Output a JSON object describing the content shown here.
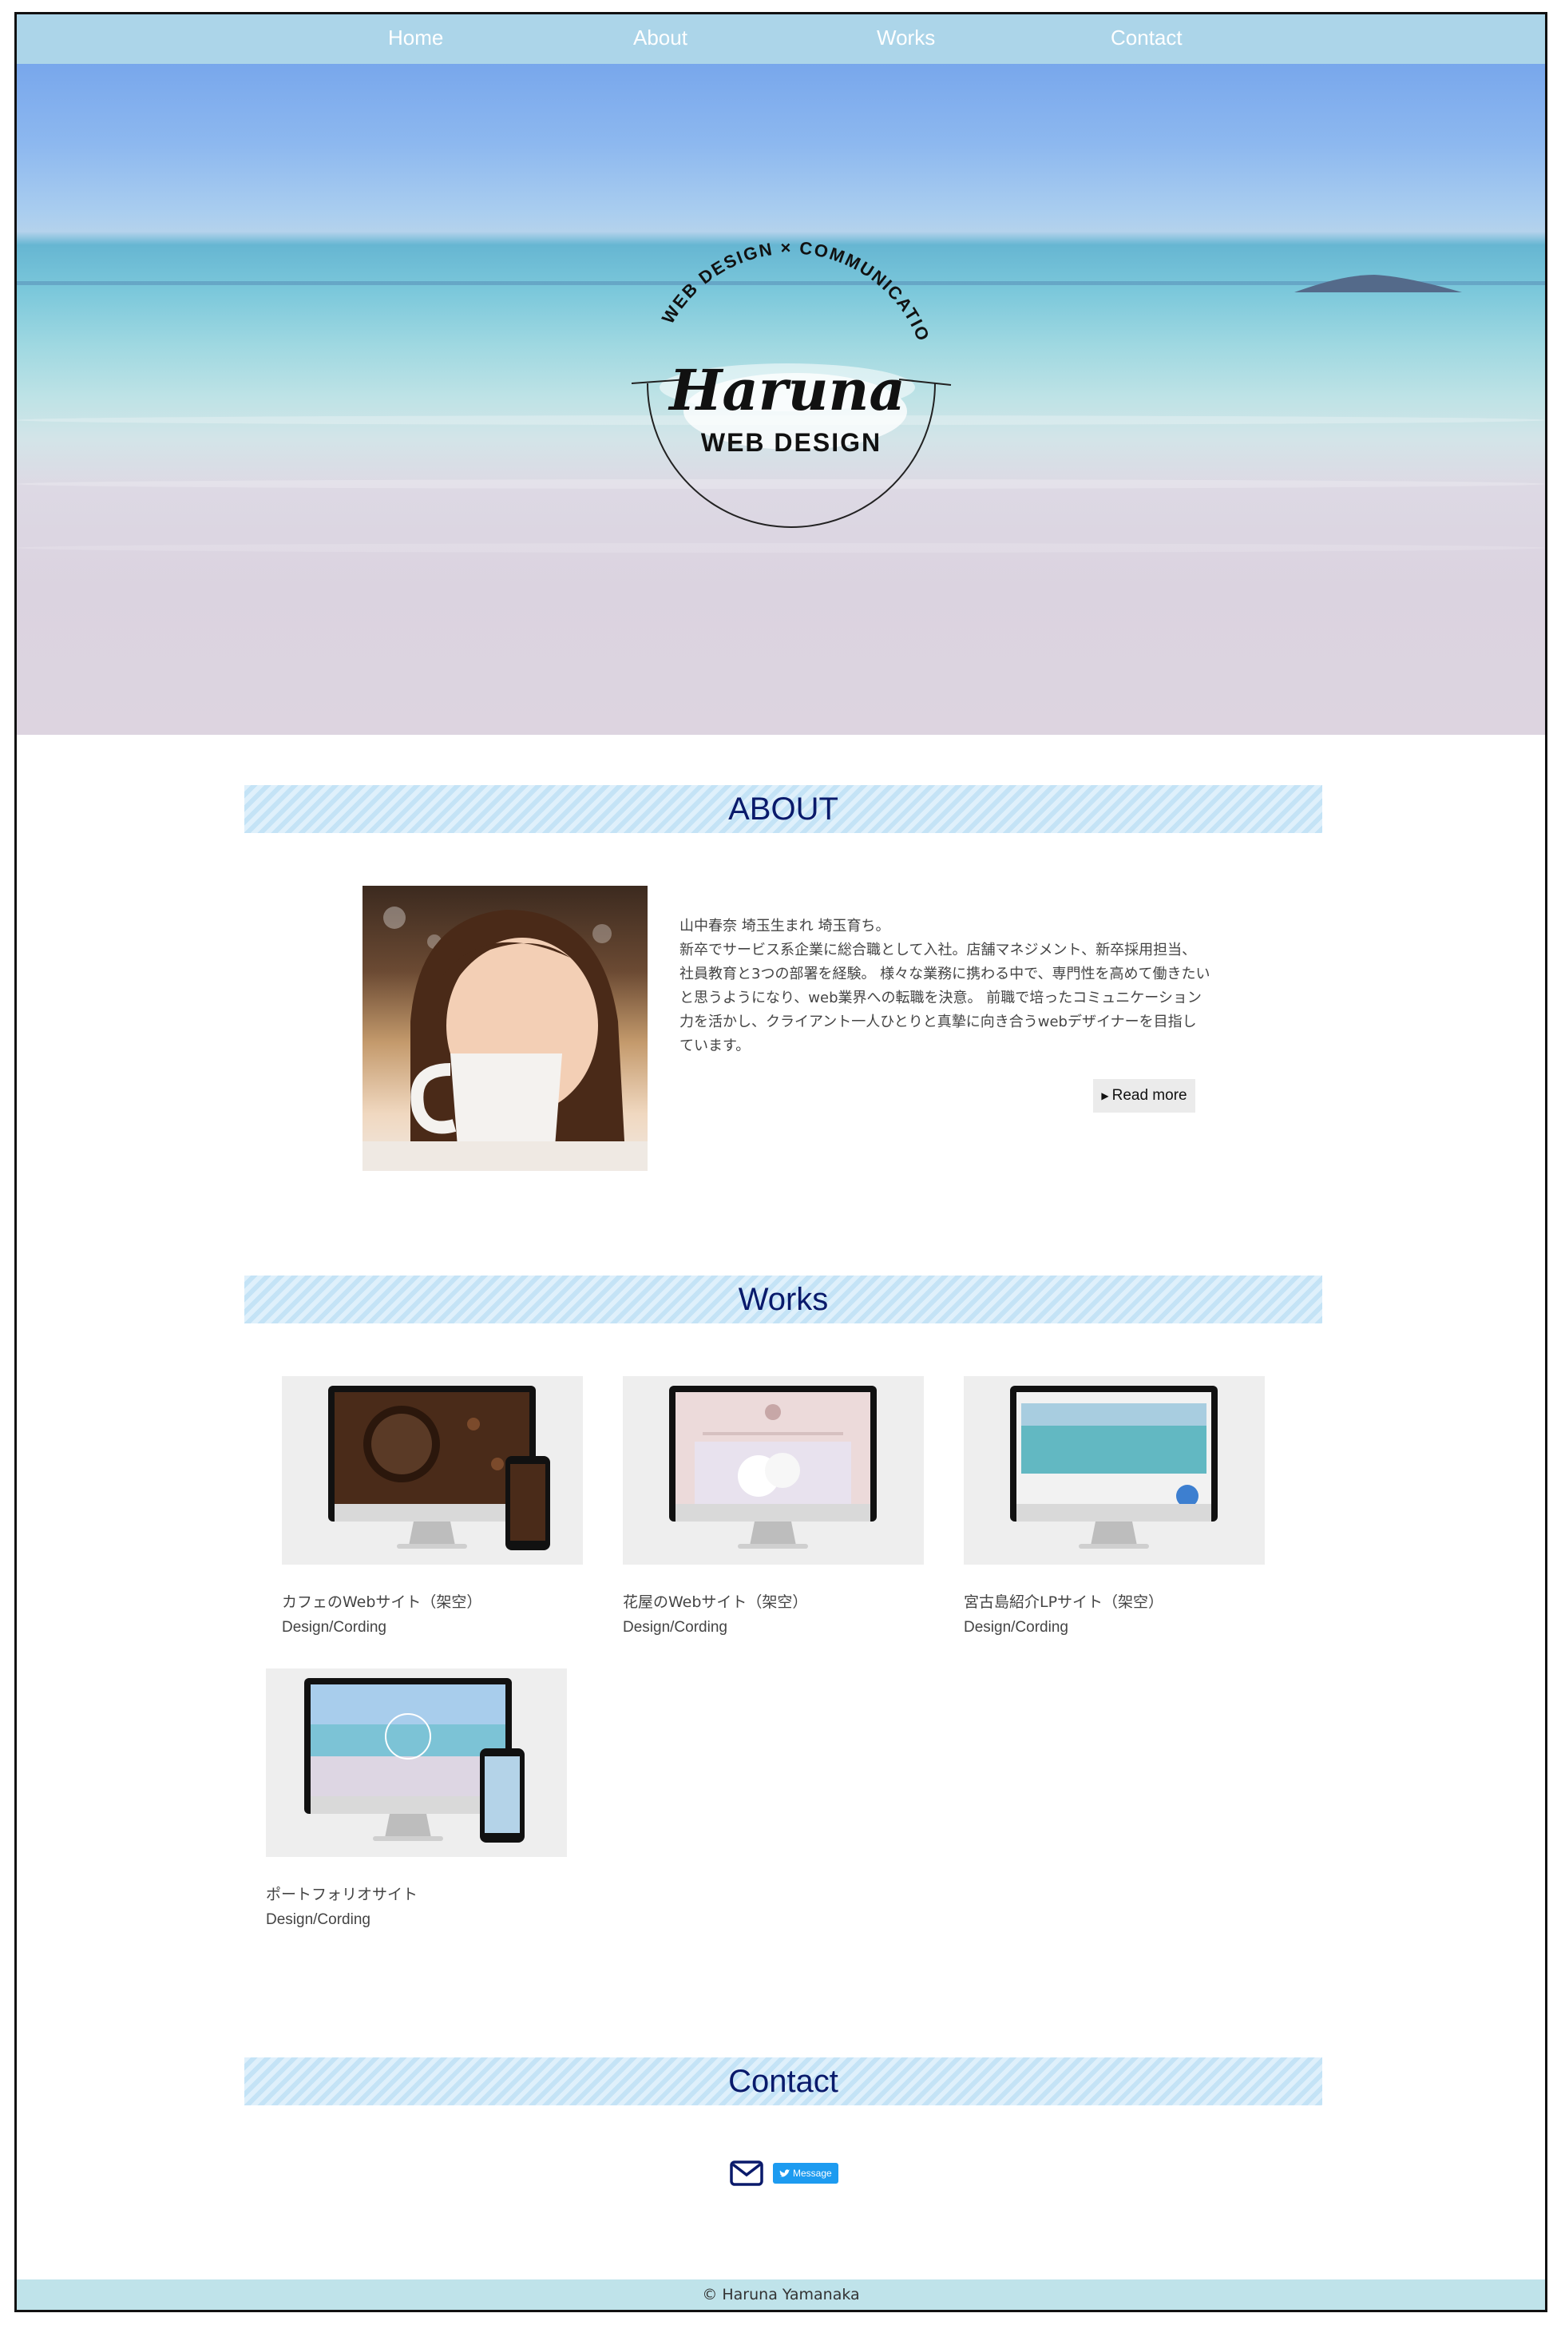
{
  "nav": {
    "items": [
      "Home",
      "About",
      "Works",
      "Contact"
    ]
  },
  "hero": {
    "logo_arc_text": "WEB DESIGN × COMMUNICATION",
    "logo_script": "Haruna",
    "logo_sub": "WEB DESIGN"
  },
  "about": {
    "heading": "ABOUT",
    "text": "山中春奈 埼玉生まれ 埼玉育ち。\n新卒でサービス系企業に総合職として入社。店舗マネジメント、新卒採用担当、社員教育と3つの部署を経験。 様々な業務に携わる中で、専門性を高めて働きたいと思うようになり、web業界への転職を決意。 前職で培ったコミュニケーション力を活かし、クライアント一人ひとりと真摯に向き合うwebデザイナーを目指しています。",
    "read_more": "Read more"
  },
  "works": {
    "heading": "Works",
    "items": [
      {
        "title": "カフェのWebサイト（架空）",
        "sub": "Design/Cording"
      },
      {
        "title": "花屋のWebサイト（架空）",
        "sub": "Design/Cording"
      },
      {
        "title": "宮古島紹介LPサイト（架空）",
        "sub": "Design/Cording"
      },
      {
        "title": "ポートフォリオサイト",
        "sub": "Design/Cording"
      }
    ]
  },
  "contact": {
    "heading": "Contact",
    "message_label": "Message"
  },
  "footer": {
    "copyright": "© Haruna Yamanaka"
  },
  "colors": {
    "nav_bg": "#acd5e9",
    "heading_text": "#0a1a6b",
    "footer_bg": "#bfe3ea",
    "twitter": "#1d9bf0"
  }
}
